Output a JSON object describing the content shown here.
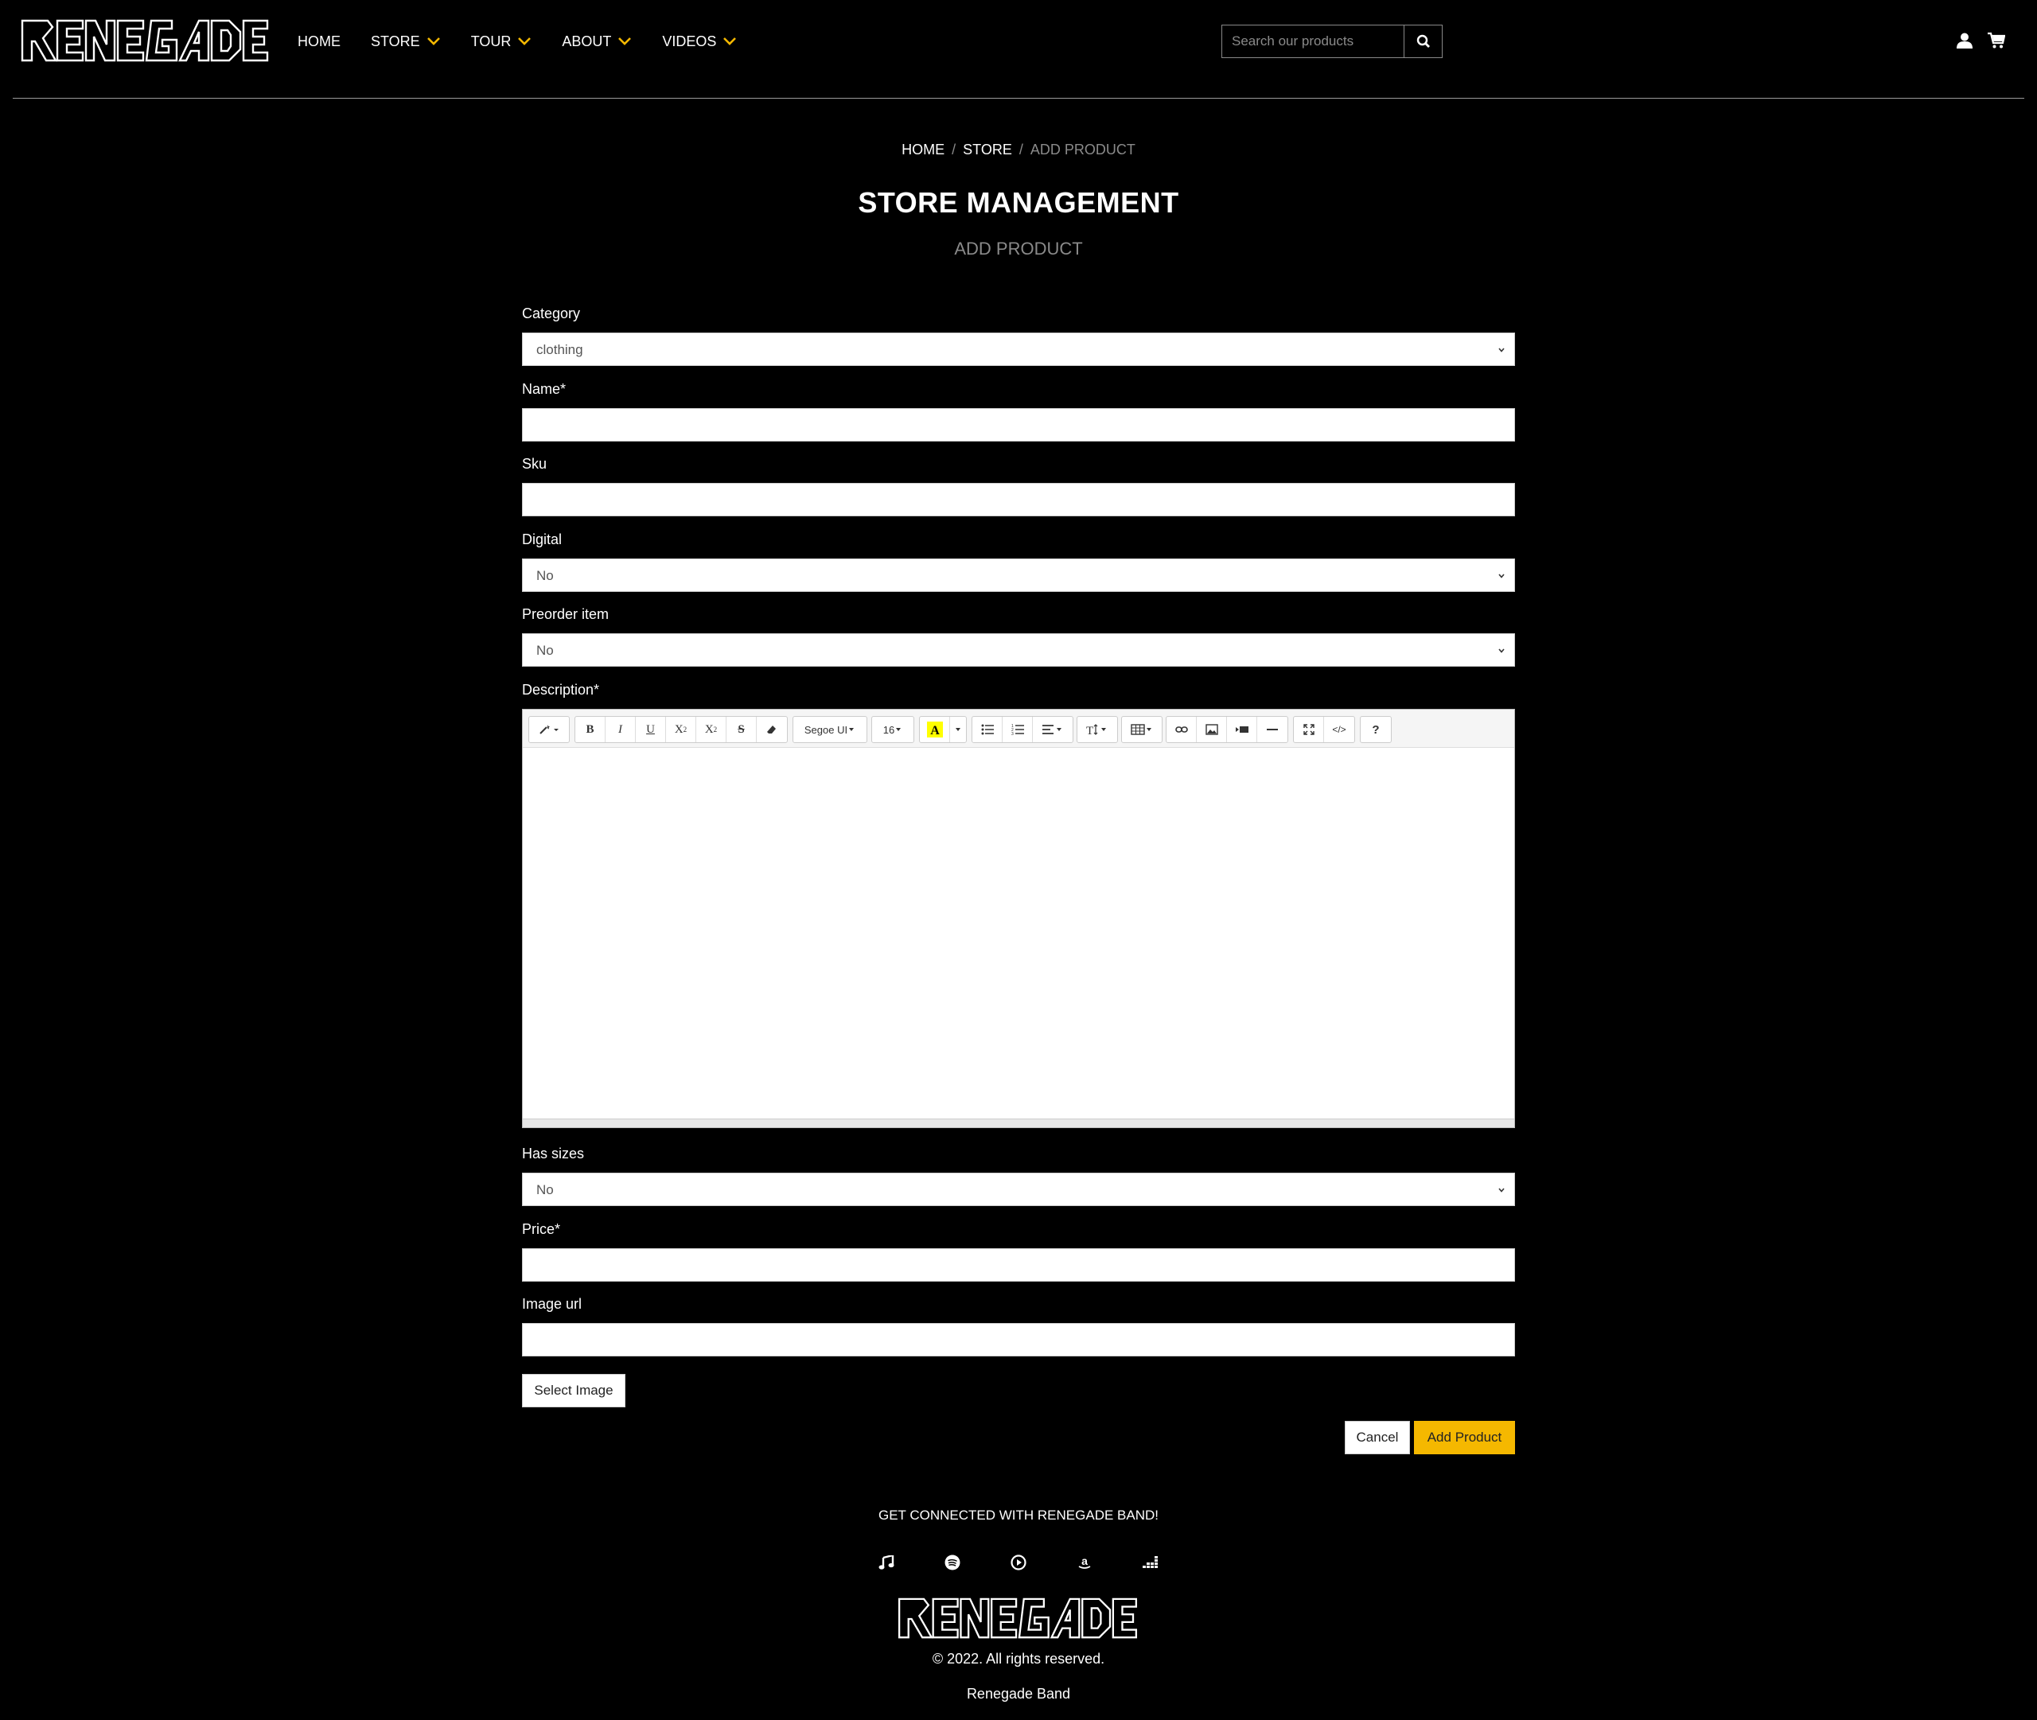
{
  "header": {
    "logo_text": "RENEGADE",
    "nav": [
      {
        "label": "HOME",
        "has_dropdown": false
      },
      {
        "label": "STORE",
        "has_dropdown": true
      },
      {
        "label": "TOUR",
        "has_dropdown": true
      },
      {
        "label": "ABOUT",
        "has_dropdown": true
      },
      {
        "label": "VIDEOS",
        "has_dropdown": true
      }
    ],
    "search_placeholder": "Search our products",
    "icons": [
      "search-icon",
      "user-icon",
      "cart-icon"
    ],
    "accent_color": "#f5b800"
  },
  "breadcrumb": {
    "home": "HOME",
    "store": "STORE",
    "current": "ADD PRODUCT",
    "separator": "/"
  },
  "page": {
    "title": "STORE MANAGEMENT",
    "subtitle": "ADD PRODUCT"
  },
  "form": {
    "category": {
      "label": "Category",
      "value": "clothing"
    },
    "name": {
      "label": "Name*",
      "value": ""
    },
    "sku": {
      "label": "Sku",
      "value": ""
    },
    "digital": {
      "label": "Digital",
      "value": "No"
    },
    "preorder": {
      "label": "Preorder item",
      "value": "No"
    },
    "description": {
      "label": "Description*",
      "toolbar": {
        "font_name": "Segoe UI",
        "font_size": "16",
        "buttons": [
          "magic-icon",
          "bold-icon",
          "italic-icon",
          "underline-icon",
          "superscript-icon",
          "subscript-icon",
          "strikethrough-icon",
          "eraser-icon",
          "highlight-icon",
          "unordered-list-icon",
          "ordered-list-icon",
          "align-icon",
          "line-height-icon",
          "table-icon",
          "link-icon",
          "image-icon",
          "video-icon",
          "hr-icon",
          "fullscreen-icon",
          "code-view-icon",
          "help-icon"
        ]
      },
      "value": ""
    },
    "has_sizes": {
      "label": "Has sizes",
      "value": "No"
    },
    "price": {
      "label": "Price*",
      "value": ""
    },
    "image_url": {
      "label": "Image url",
      "value": ""
    },
    "select_image": "Select Image",
    "cancel": "Cancel",
    "submit": "Add Product"
  },
  "footer": {
    "title": "GET CONNECTED WITH RENEGADE BAND!",
    "social": [
      "music-note-icon",
      "spotify-icon",
      "play-circle-icon",
      "amazon-icon",
      "deezer-icon"
    ],
    "logo_text": "RENEGADE",
    "copyright": "© 2022. All rights reserved.",
    "band": "Renegade Band"
  }
}
